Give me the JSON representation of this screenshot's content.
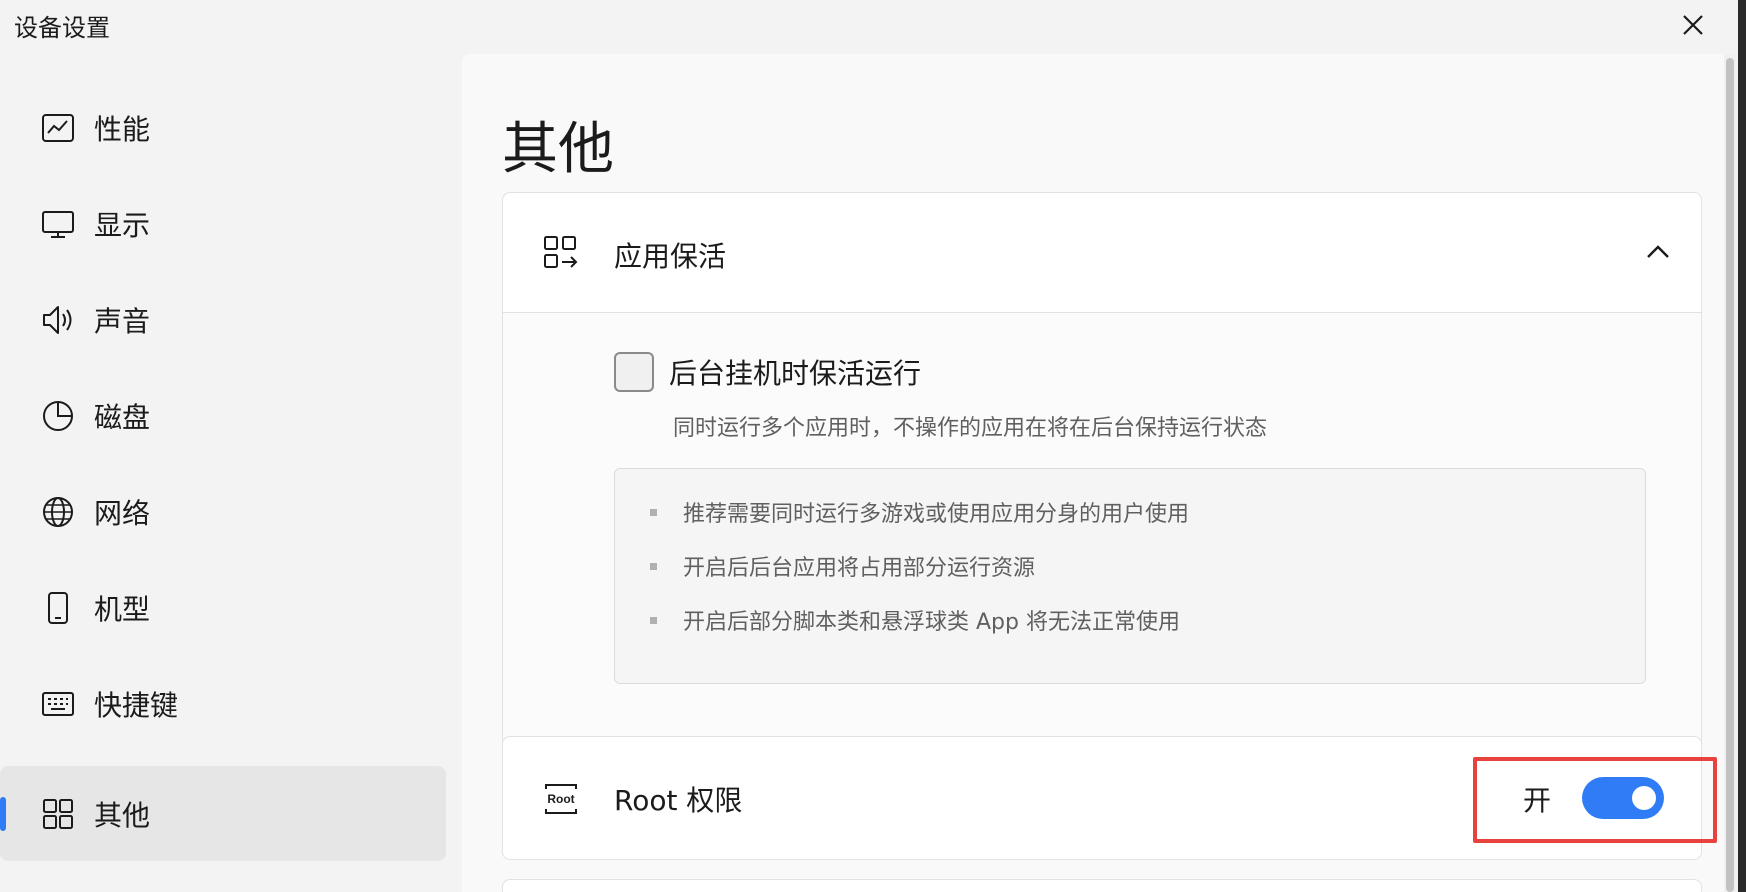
{
  "window": {
    "title": "设备设置"
  },
  "sidebar": {
    "items": [
      {
        "label": "性能",
        "icon": "performance-chart-icon"
      },
      {
        "label": "显示",
        "icon": "monitor-icon"
      },
      {
        "label": "声音",
        "icon": "speaker-icon"
      },
      {
        "label": "磁盘",
        "icon": "pie-chart-icon"
      },
      {
        "label": "网络",
        "icon": "globe-icon"
      },
      {
        "label": "机型",
        "icon": "phone-icon"
      },
      {
        "label": "快捷键",
        "icon": "keyboard-icon"
      },
      {
        "label": "其他",
        "icon": "grid-icon",
        "active": true
      }
    ]
  },
  "main": {
    "title": "其他",
    "keepalive": {
      "header": "应用保活",
      "expanded": true,
      "checkbox_label": "后台挂机时保活运行",
      "checked": false,
      "description": "同时运行多个应用时，不操作的应用在将在后台保持运行状态",
      "tips": [
        "推荐需要同时运行多游戏或使用应用分身的用户使用",
        "开启后后台应用将占用部分运行资源",
        "开启后部分脚本类和悬浮球类 App 将无法正常使用"
      ]
    },
    "root": {
      "label": "Root 权限",
      "icon_text": "Root",
      "state_label": "开",
      "enabled": true
    }
  },
  "colors": {
    "accent": "#2f7cf6",
    "highlight": "#e8423f"
  }
}
